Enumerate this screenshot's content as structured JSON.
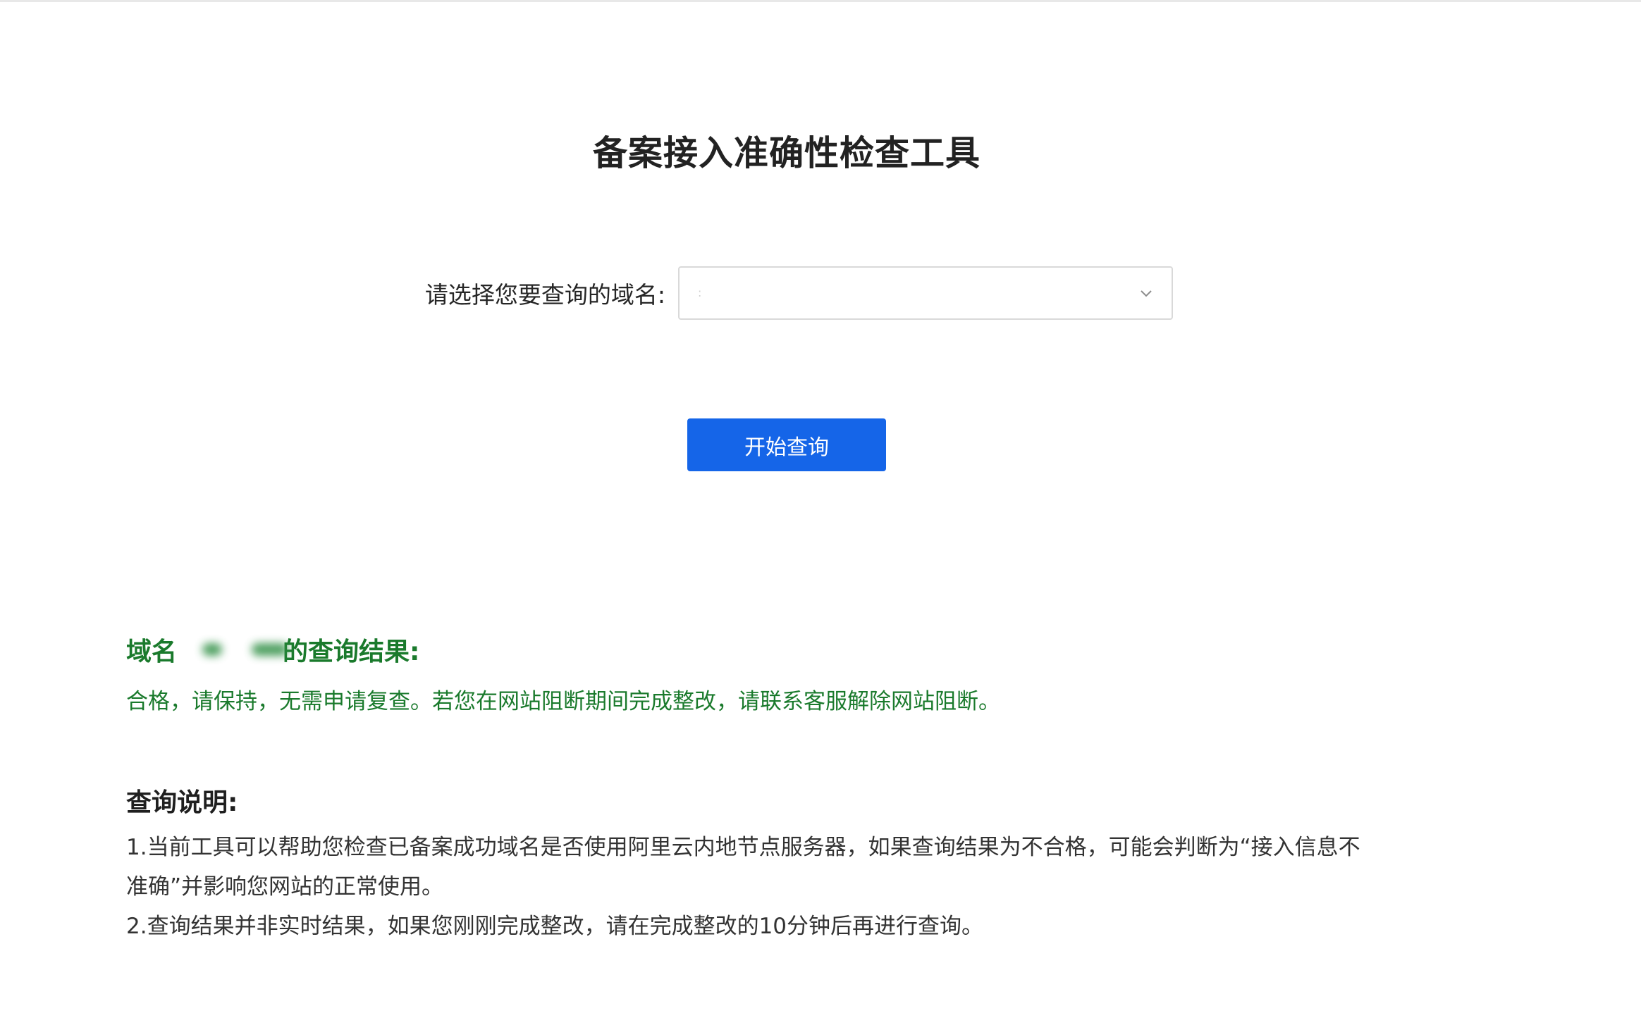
{
  "page": {
    "title": "备案接入准确性检查工具"
  },
  "form": {
    "label": "请选择您要查询的域名:",
    "select_value": ":",
    "chevron_icon": "chevron-down-icon"
  },
  "actions": {
    "query_label": "开始查询"
  },
  "result": {
    "title_prefix": "域名",
    "title_suffix": "的查询结果:",
    "message": "合格，请保持，无需申请复查。若您在网站阻断期间完成整改，请联系客服解除网站阻断。",
    "color": "#1a7a2c"
  },
  "notes": {
    "title": "查询说明:",
    "lines": [
      "1.当前工具可以帮助您检查已备案成功域名是否使用阿里云内地节点服务器，如果查询结果为不合格，可能会判断为“接入信息不",
      "准确”并影响您网站的正常使用。",
      "2.查询结果并非实时结果，如果您刚刚完成整改，请在完成整改的10分钟后再进行查询。"
    ]
  },
  "colors": {
    "primary": "#1565e8",
    "success": "#1a7a2c"
  }
}
